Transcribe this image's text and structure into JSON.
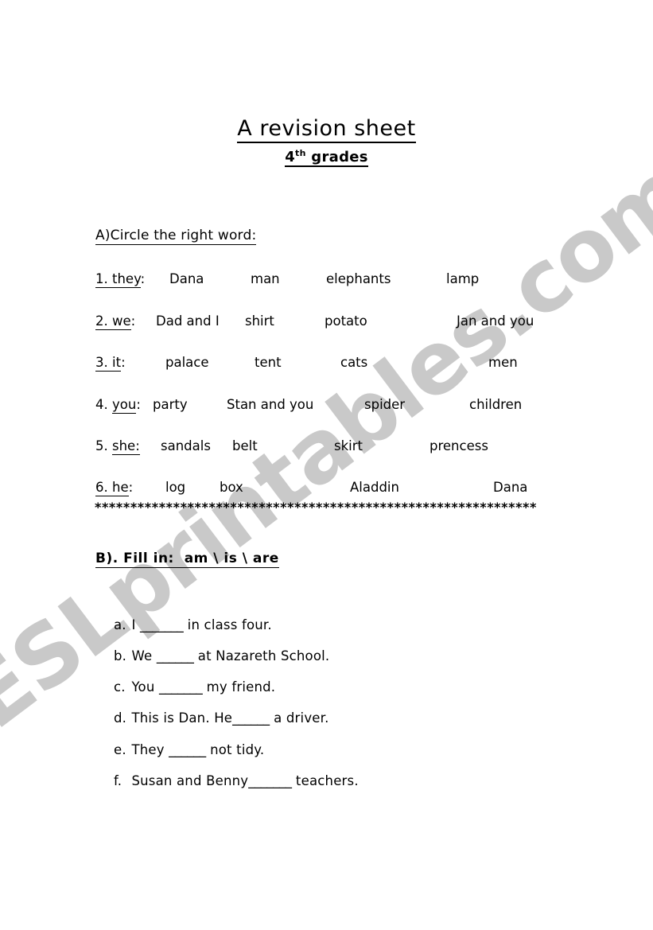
{
  "watermark": {
    "text": "ESLprintables.com",
    "color": "#c9c9c9"
  },
  "title": {
    "main": "A revision sheet",
    "grade_number": "4",
    "grade_ordinal": "th",
    "grade_word": "grades"
  },
  "section_a": {
    "heading": "A)Circle the right word:",
    "questions": [
      {
        "number": "1.",
        "pronoun": "they",
        "colon": ":",
        "options": [
          "Dana",
          "man",
          "elephants",
          "lamp"
        ]
      },
      {
        "number": "2.",
        "pronoun": "we",
        "colon": ":",
        "options": [
          "Dad  and I",
          "shirt",
          "potato",
          "Jan and you"
        ]
      },
      {
        "number": "3.",
        "pronoun": "it",
        "colon": ":",
        "options": [
          "palace",
          "tent",
          "cats",
          "men"
        ]
      },
      {
        "number": "4.",
        "pronoun": "you",
        "colon": ":",
        "options": [
          "party",
          "Stan and you",
          "spider",
          "children"
        ]
      },
      {
        "number": "5.",
        "pronoun": "she",
        "colon": ":",
        "options": [
          "sandals",
          "belt",
          "skirt",
          "prencess"
        ]
      },
      {
        "number": "6.",
        "pronoun": "he",
        "colon": ":",
        "options": [
          "log",
          "box",
          "Aladdin",
          "Dana"
        ]
      }
    ]
  },
  "divider": {
    "text": "**************************************************************"
  },
  "section_b": {
    "heading_prefix": "B). Fill in:",
    "heading_options": "am  \\  is  \\  are",
    "items": [
      {
        "marker": "a.",
        "before": "I ",
        "blank": "_______",
        "after": " in class four."
      },
      {
        "marker": "b.",
        "before": "We ",
        "blank": "______",
        "after": " at Nazareth School."
      },
      {
        "marker": "c.",
        "before": "You ",
        "blank": "_______",
        "after": " my friend."
      },
      {
        "marker": "d.",
        "before": "This is Dan. He",
        "blank": "______",
        "after": " a driver."
      },
      {
        "marker": "e.",
        "before": "They ",
        "blank": "______",
        "after": " not tidy."
      },
      {
        "marker": "f.",
        "before": "Susan and Benny",
        "blank": "_______",
        "after": " teachers."
      }
    ]
  }
}
